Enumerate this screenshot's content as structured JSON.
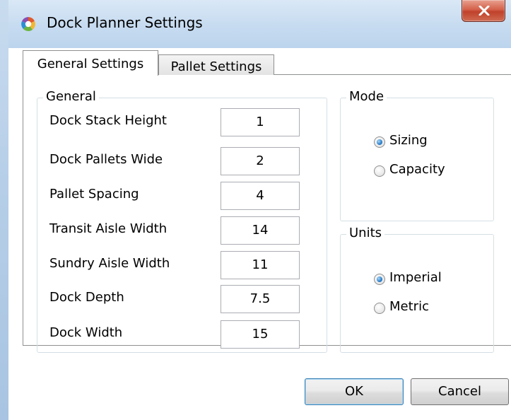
{
  "window": {
    "title": "Dock Planner Settings"
  },
  "tabs": [
    {
      "label": "General Settings",
      "selected": true
    },
    {
      "label": "Pallet Settings",
      "selected": false
    }
  ],
  "general": {
    "legend": "General",
    "fields": [
      {
        "label": "Dock Stack Height",
        "value": "1"
      },
      {
        "label": "Dock Pallets Wide",
        "value": "2"
      },
      {
        "label": "Pallet Spacing",
        "value": "4"
      },
      {
        "label": "Transit Aisle Width",
        "value": "14"
      },
      {
        "label": "Sundry Aisle Width",
        "value": "11"
      },
      {
        "label": "Dock Depth",
        "value": "7.5"
      },
      {
        "label": "Dock Width",
        "value": "15"
      }
    ]
  },
  "mode": {
    "legend": "Mode",
    "options": [
      {
        "label": "Sizing",
        "checked": true
      },
      {
        "label": "Capacity",
        "checked": false
      }
    ]
  },
  "units": {
    "legend": "Units",
    "options": [
      {
        "label": "Imperial",
        "checked": true
      },
      {
        "label": "Metric",
        "checked": false
      }
    ]
  },
  "buttons": {
    "ok_label": "OK",
    "cancel_label": "Cancel"
  },
  "colors": {
    "titlebar": "#c6dbf0",
    "close_button": "#c0412b",
    "radio_checked": "#2c7ec8",
    "default_button_border": "#3c7fb1"
  },
  "icons": {
    "app": "app-logo-icon",
    "close": "close-icon"
  }
}
